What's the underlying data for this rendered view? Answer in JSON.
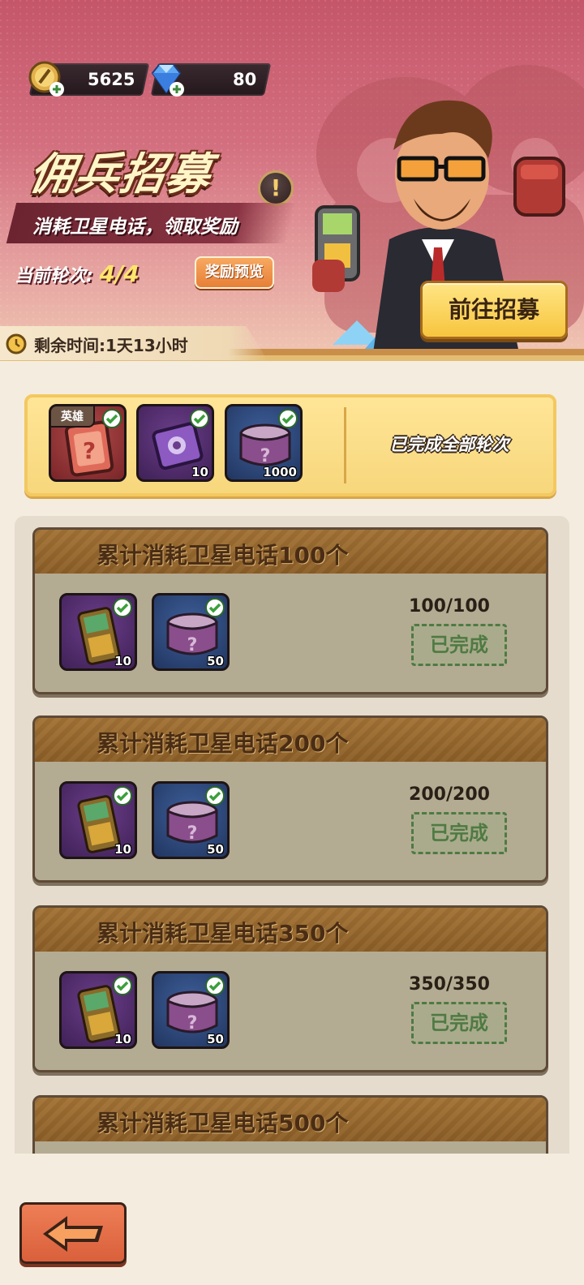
{
  "header": {
    "gold_amount": "5625",
    "gem_amount": "80",
    "gold_icon": "gold-coin-plus-icon",
    "gem_icon": "diamond-plus-icon"
  },
  "banner": {
    "title": "佣兵招募",
    "subtitle": "消耗卫星电话，领取奖励",
    "round_label": "当前轮次:",
    "round_value": "4/4",
    "reward_preview_label": "奖励预览",
    "go_recruit_label": "前往招募",
    "info_icon": "exclamation-icon",
    "remaining_time": "剩余时间:1天13小时"
  },
  "summary": {
    "hero_tag": "英雄",
    "items": [
      {
        "icon": "hero-card-icon",
        "qty": ""
      },
      {
        "icon": "purple-chip-icon",
        "qty": "10"
      },
      {
        "icon": "mystery-can-icon",
        "qty": "1000"
      }
    ],
    "status": "已完成全部轮次"
  },
  "tasks": [
    {
      "title": "累计消耗卫星电话100个",
      "progress": "100/100",
      "status": "已完成",
      "rewards": [
        {
          "icon": "satellite-phone-icon",
          "qty": "10"
        },
        {
          "icon": "mystery-can-icon",
          "qty": "50"
        }
      ]
    },
    {
      "title": "累计消耗卫星电话200个",
      "progress": "200/200",
      "status": "已完成",
      "rewards": [
        {
          "icon": "satellite-phone-icon",
          "qty": "10"
        },
        {
          "icon": "mystery-can-icon",
          "qty": "50"
        }
      ]
    },
    {
      "title": "累计消耗卫星电话350个",
      "progress": "350/350",
      "status": "已完成",
      "rewards": [
        {
          "icon": "satellite-phone-icon",
          "qty": "10"
        },
        {
          "icon": "mystery-can-icon",
          "qty": "50"
        }
      ]
    },
    {
      "title": "累计消耗卫星电话500个"
    }
  ],
  "footer": {
    "back_icon": "back-arrow-icon"
  },
  "colors": {
    "banner": "#c5566a",
    "gold_button": "#f7c53e",
    "done_green": "#4f7a43",
    "back_button": "#d9603b"
  }
}
